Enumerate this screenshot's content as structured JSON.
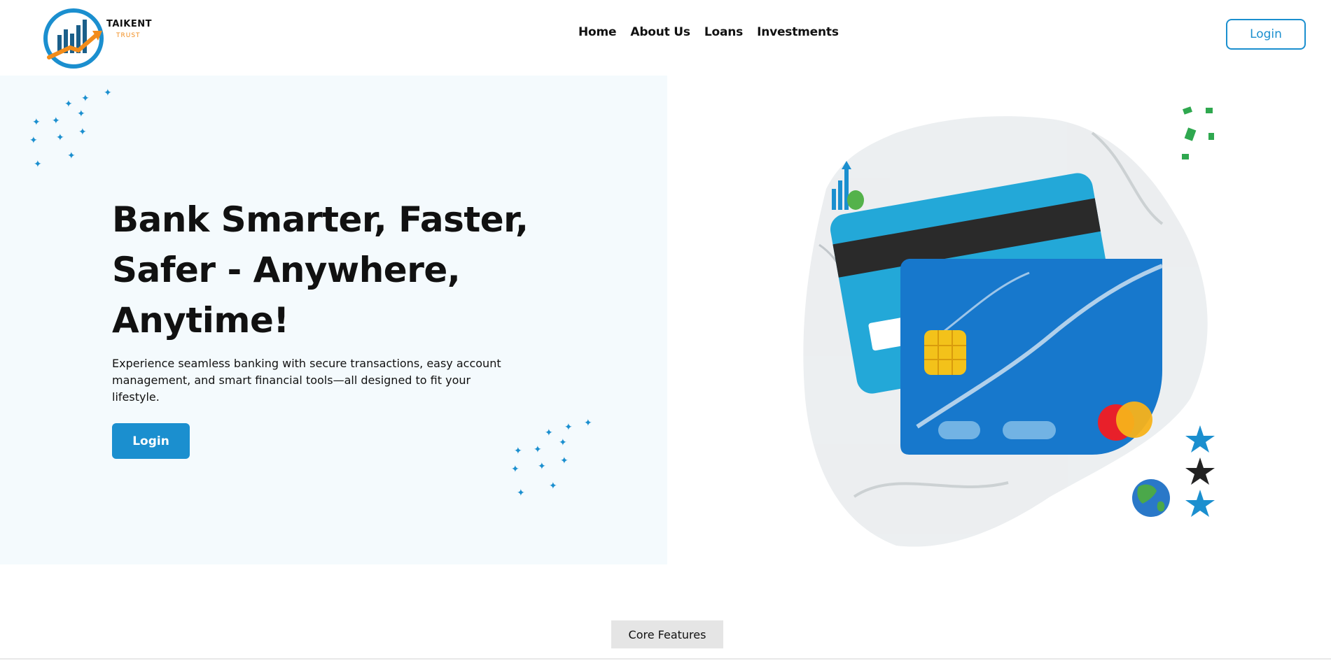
{
  "brand": {
    "name": "TAIKENT",
    "tagline": "TRUST",
    "primary_color": "#1b8fcf",
    "accent_color": "#f28c1b"
  },
  "nav": {
    "items": [
      {
        "label": "Home"
      },
      {
        "label": "About Us"
      },
      {
        "label": "Loans"
      },
      {
        "label": "Investments"
      }
    ],
    "login_label": "Login"
  },
  "hero": {
    "title": "Bank Smarter, Faster, Safer - Anywhere, Anytime!",
    "subtitle": "Experience seamless banking with secure transactions, easy account management, and smart financial tools—all designed to fit your lifestyle.",
    "cta_label": "Login",
    "background_color": "#f4fafd"
  },
  "illustration": {
    "icons": [
      "bar-chart-icon",
      "credit-card-icon",
      "globe-icon",
      "star-icon",
      "money-icon"
    ]
  },
  "sections": {
    "core_features_label": "Core Features"
  }
}
